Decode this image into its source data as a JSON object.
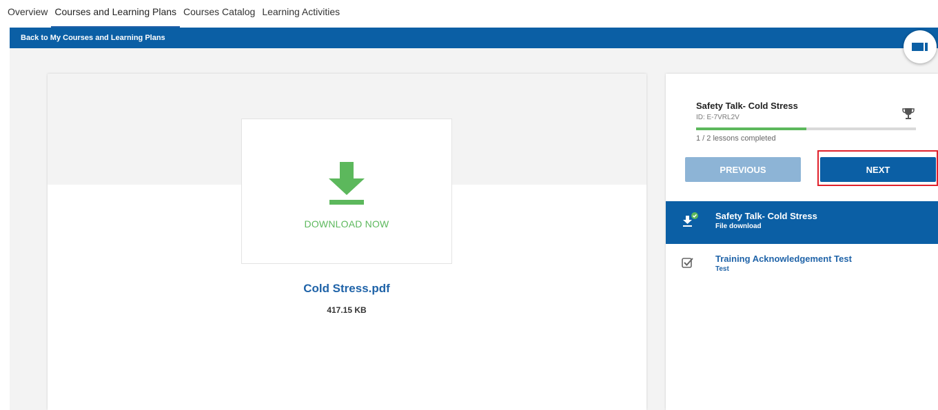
{
  "top_tabs": [
    "Overview",
    "Courses and Learning Plans",
    "Courses Catalog",
    "Learning Activities"
  ],
  "active_tab": "Courses and Learning Plans",
  "back_link": "Back to My Courses and Learning Plans",
  "colors": {
    "primary": "#0b5fa5",
    "success": "#5cb85c",
    "link": "#1f63a8",
    "highlight": "#e0202a"
  },
  "download": {
    "label": "DOWNLOAD NOW",
    "file_name": "Cold Stress.pdf",
    "file_size": "417.15 KB",
    "icon": "download-icon"
  },
  "course": {
    "title": "Safety Talk- Cold Stress",
    "id_text": "ID: E-7VRL2V",
    "progress_fraction": 0.5,
    "lessons_completed": "1 / 2 lessons completed",
    "icon": "trophy-icon"
  },
  "buttons": {
    "previous": "PREVIOUS",
    "next": "NEXT"
  },
  "lessons": [
    {
      "title": "Safety Talk- Cold Stress",
      "subtitle": "File download",
      "icon": "download-completed-icon",
      "active": true
    },
    {
      "title": "Training Acknowledgement Test",
      "subtitle": "Test",
      "icon": "checkbox-icon",
      "active": false
    }
  ]
}
